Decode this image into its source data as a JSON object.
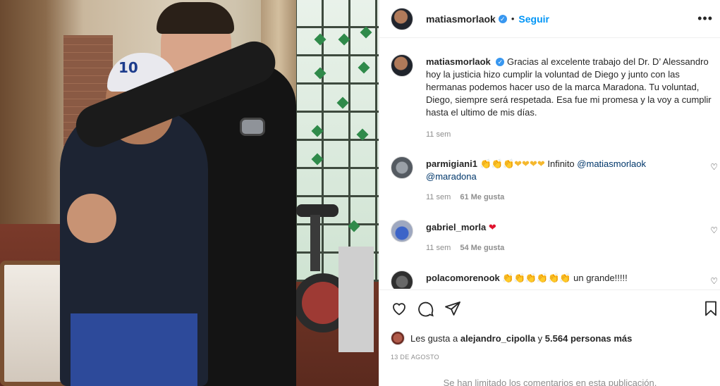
{
  "post": {
    "username": "matiasmorlaok",
    "separator": "•",
    "follow_label": "Seguir",
    "more_label": "•••"
  },
  "photo": {
    "cap_text": "10"
  },
  "caption": {
    "username": "matiasmorlaok",
    "text": "Gracias al excelente trabajo del Dr. D’ Alessandro hoy la justicia hizo cumplir la voluntad de Diego y junto con las hermanas podemos hacer uso de la marca Maradona. Tu voluntad, Diego, siempre será respetada. Esa fue mi promesa y la voy a cumplir hasta el ultimo de mis días.",
    "time": "11 sem"
  },
  "comments": [
    {
      "username": "parmigiani1",
      "emojis": "👏👏👏❤❤❤❤",
      "text": "Infinito",
      "mention1": "@matiasmorlaok",
      "mention2": "@maradona",
      "time": "11 sem",
      "likes": "61 Me gusta"
    },
    {
      "username": "gabriel_morla",
      "emojis": "❤",
      "time": "11 sem",
      "likes": "54 Me gusta"
    },
    {
      "username": "polacomorenook",
      "emojis": "👏👏👏👏👏👏",
      "text": "un grande!!!!!"
    }
  ],
  "likes": {
    "prefix": "Les gusta a",
    "user": "alejandro_cipolla",
    "middle": "y",
    "count": "5.564 personas más"
  },
  "date": "13 DE AGOSTO",
  "limited_notice": "Se han limitado los comentarios en esta publicación.",
  "colors": {
    "link": "#00376b",
    "follow": "#0095f6",
    "meta": "#8e8e8e"
  }
}
